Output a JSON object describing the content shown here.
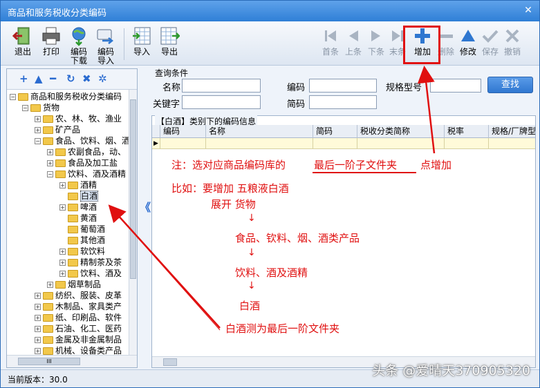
{
  "window": {
    "title": "商品和服务税收分类编码",
    "close_glyph": "✕"
  },
  "toolbar": {
    "exit": "退出",
    "print": "打印",
    "code_download": [
      "编码",
      "下载"
    ],
    "code_import": [
      "编码",
      "导入"
    ],
    "import": "导入",
    "export": "导出",
    "first": "首条",
    "prev": "上条",
    "next": "下条",
    "last": "末条",
    "add": "增加",
    "delete": "删除",
    "modify": "修改",
    "save": "保存",
    "cancel": "撤销"
  },
  "tree_tools": [
    "+",
    "▲",
    "━",
    "↻",
    "✖",
    "✲"
  ],
  "tree": [
    {
      "label": "商品和服务税收分类编码",
      "level": 0,
      "toggle": "−"
    },
    {
      "label": "货物",
      "level": 1,
      "toggle": "−"
    },
    {
      "label": "农、林、牧、渔业",
      "level": 2,
      "toggle": "+"
    },
    {
      "label": "矿产品",
      "level": 2,
      "toggle": "+"
    },
    {
      "label": "食品、饮料、烟、酒",
      "level": 2,
      "toggle": "−"
    },
    {
      "label": "农副食品，动、",
      "level": 3,
      "toggle": "+"
    },
    {
      "label": "食品及加工盐",
      "level": 3,
      "toggle": "+"
    },
    {
      "label": "饮料、酒及酒精",
      "level": 3,
      "toggle": "−"
    },
    {
      "label": "酒精",
      "level": 4,
      "toggle": "+"
    },
    {
      "label": "白酒",
      "level": 4,
      "toggle": "",
      "selected": true
    },
    {
      "label": "啤酒",
      "level": 4,
      "toggle": "+"
    },
    {
      "label": "黄酒",
      "level": 4,
      "toggle": ""
    },
    {
      "label": "葡萄酒",
      "level": 4,
      "toggle": ""
    },
    {
      "label": "其他酒",
      "level": 4,
      "toggle": ""
    },
    {
      "label": "软饮料",
      "level": 4,
      "toggle": "+"
    },
    {
      "label": "精制茶及茶",
      "level": 4,
      "toggle": "+"
    },
    {
      "label": "饮料、酒及",
      "level": 4,
      "toggle": "+"
    },
    {
      "label": "烟草制品",
      "level": 3,
      "toggle": "+"
    },
    {
      "label": "纺织、服装、皮革",
      "level": 2,
      "toggle": "+"
    },
    {
      "label": "木制品、家具类产",
      "level": 2,
      "toggle": "+"
    },
    {
      "label": "纸、印刷品、软件",
      "level": 2,
      "toggle": "+"
    },
    {
      "label": "石油、化工、医药",
      "level": 2,
      "toggle": "+"
    },
    {
      "label": "金属及非金属制品",
      "level": 2,
      "toggle": "+"
    },
    {
      "label": "机械、设备类产品",
      "level": 2,
      "toggle": "+"
    }
  ],
  "tree_scroll_glyph": "III",
  "collapse_glyph": "《",
  "query": {
    "title": "查询条件",
    "name_label": "名称",
    "code_label": "编码",
    "spec_label": "规格型号",
    "keyword_label": "关键字",
    "abbr_label": "简码",
    "search_button": "查找"
  },
  "grid": {
    "caption": "【白酒】类别下的编码信息",
    "columns": [
      "编码",
      "名称",
      "简码",
      "税收分类简称",
      "税率",
      "规格/厂牌型"
    ],
    "row_marker": "▶"
  },
  "status": {
    "version": "当前版本：30.0"
  },
  "watermark": "头条 @爱晴天370905320",
  "annotations": {
    "note_prefix": "注：选对应商品编码库的",
    "note_highlight": "最后一阶子文件夹",
    "note_suffix": "点增加",
    "example": "比如：要增加  五粮液白酒",
    "step_expand": "展开  货物",
    "step_1": "食品、钦料、烟、酒类产品",
    "step_2": "饮料、酒及酒精",
    "step_3": "白酒",
    "arrow_glyph": "↓",
    "footer": "白酒测为最后一阶文件夹"
  },
  "colors": {
    "annotation_red": "#e01010",
    "accent_blue": "#2f77d0"
  }
}
